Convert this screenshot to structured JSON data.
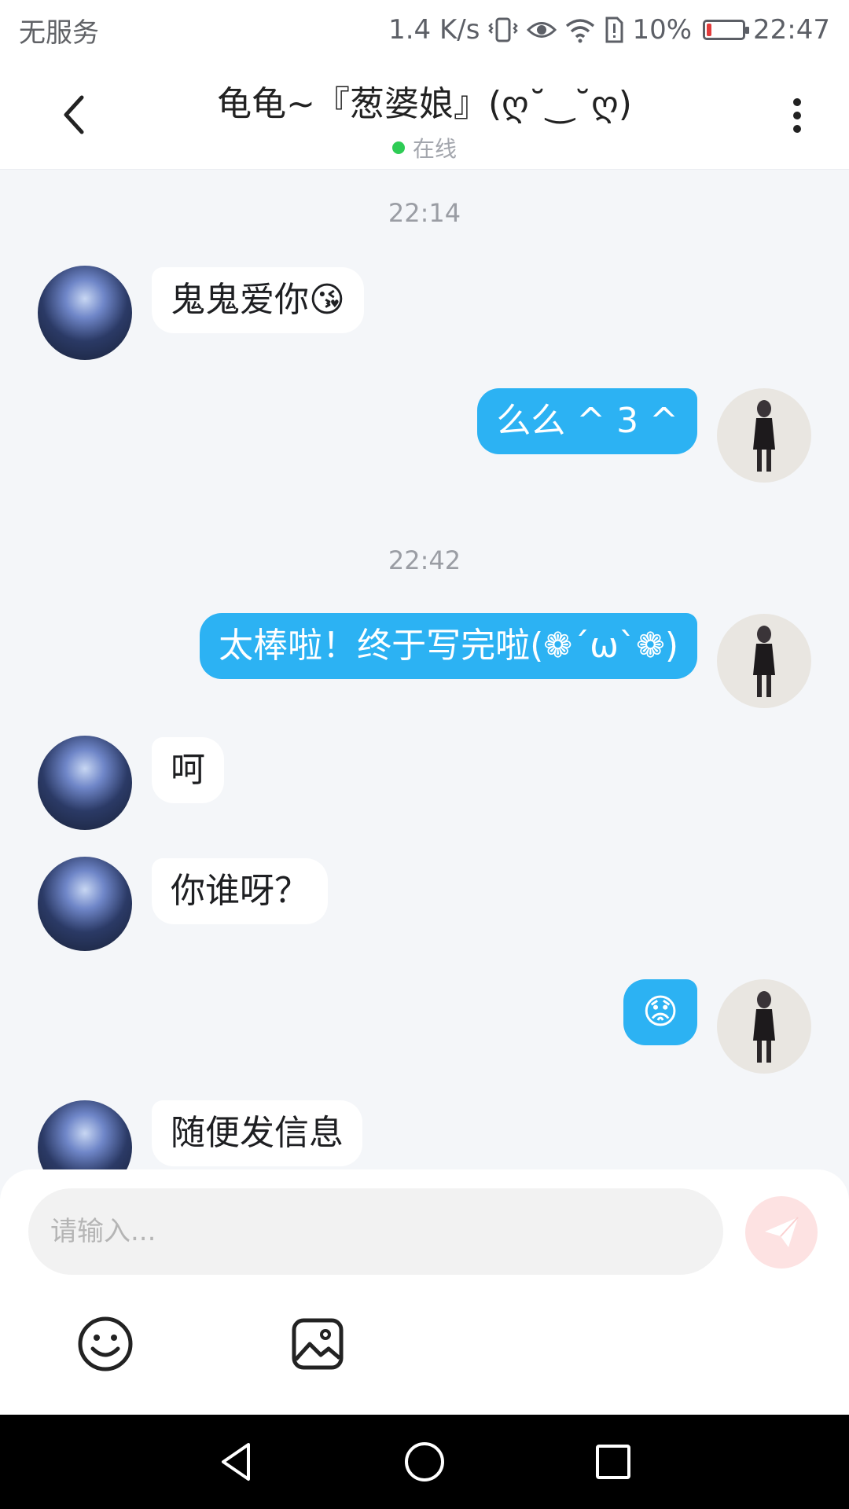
{
  "status_bar": {
    "carrier": "无服务",
    "speed": "1.4 K/s",
    "battery_percent": "10%",
    "battery_level": 0.1,
    "time": "22:47"
  },
  "header": {
    "title": "龟龟~『葱婆娘』(ღ˘‿˘ღ)",
    "presence": "在线"
  },
  "messages": [
    {
      "type": "time",
      "text": "22:14"
    },
    {
      "type": "in",
      "text": "鬼鬼爱你😘"
    },
    {
      "type": "out",
      "text": "么么 ^ 3 ^"
    },
    {
      "type": "time",
      "text": "22:42"
    },
    {
      "type": "out",
      "text": "太棒啦！终于写完啦(❁´ω`❁)"
    },
    {
      "type": "in",
      "text": "呵"
    },
    {
      "type": "in",
      "text": "你谁呀？"
    },
    {
      "type": "out",
      "text": "😟"
    },
    {
      "type": "in",
      "text": "随便发信息"
    }
  ],
  "composer": {
    "placeholder": "请输入..."
  },
  "colors": {
    "accent": "#2cb2f3",
    "online": "#2ecc55"
  },
  "icons": {
    "back": "chevron-left-icon",
    "more": "more-vertical-icon",
    "send": "send-icon",
    "emoji": "smiley-icon",
    "image": "image-icon"
  }
}
